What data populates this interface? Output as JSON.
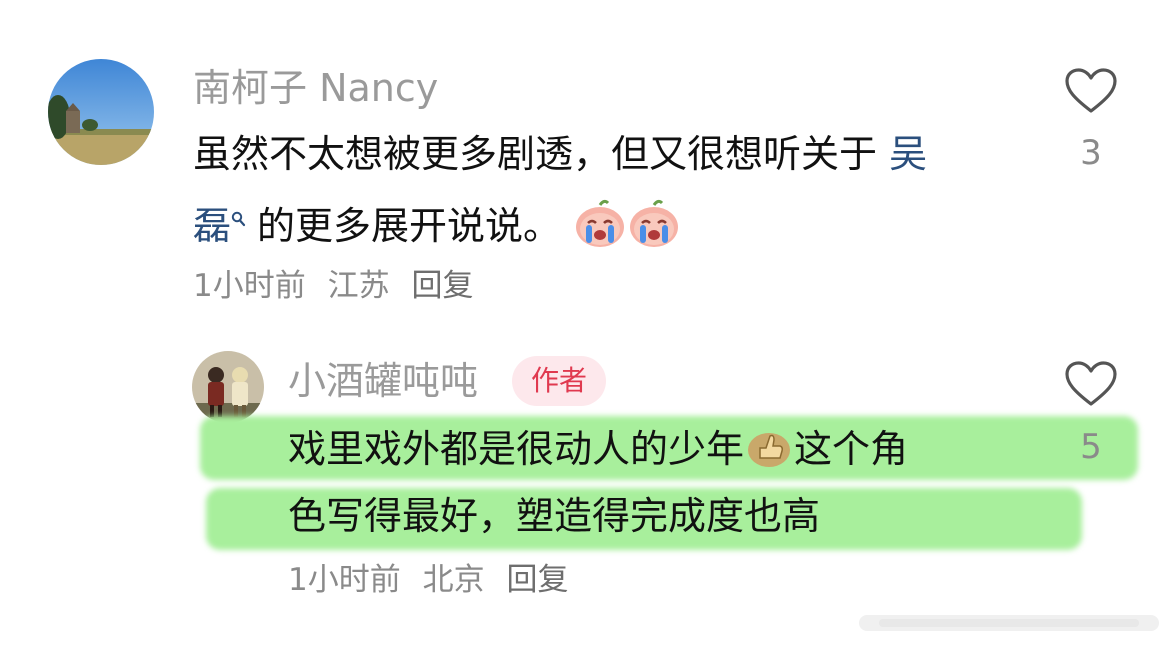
{
  "comments": [
    {
      "username": "南柯子 Nancy",
      "text_line1": "虽然不太想被更多剧透，但又很想听关于",
      "mention_part1": "吴",
      "mention_part2": "磊",
      "text_line2_rest": "的更多展开说说。",
      "time": "1小时前",
      "location": "江苏",
      "reply_label": "回复",
      "like_count": "3",
      "emojis": [
        "crying-emoji",
        "crying-emoji"
      ]
    },
    {
      "username": "小酒罐吨吨",
      "badge": "作者",
      "text_line1_a": "戏里戏外都是很动人的少年",
      "text_line1_b": "这个角",
      "text_line2": "色写得最好，塑造得完成度也高",
      "time": "1小时前",
      "location": "北京",
      "reply_label": "回复",
      "like_count": "5",
      "emojis": [
        "thumbs-up-emoji"
      ]
    }
  ],
  "colors": {
    "username": "#9a9a9a",
    "mention": "#2b4f7d",
    "badge_bg": "#fde8ec",
    "badge_text": "#e0394f",
    "highlight": "#a8ef9c"
  }
}
